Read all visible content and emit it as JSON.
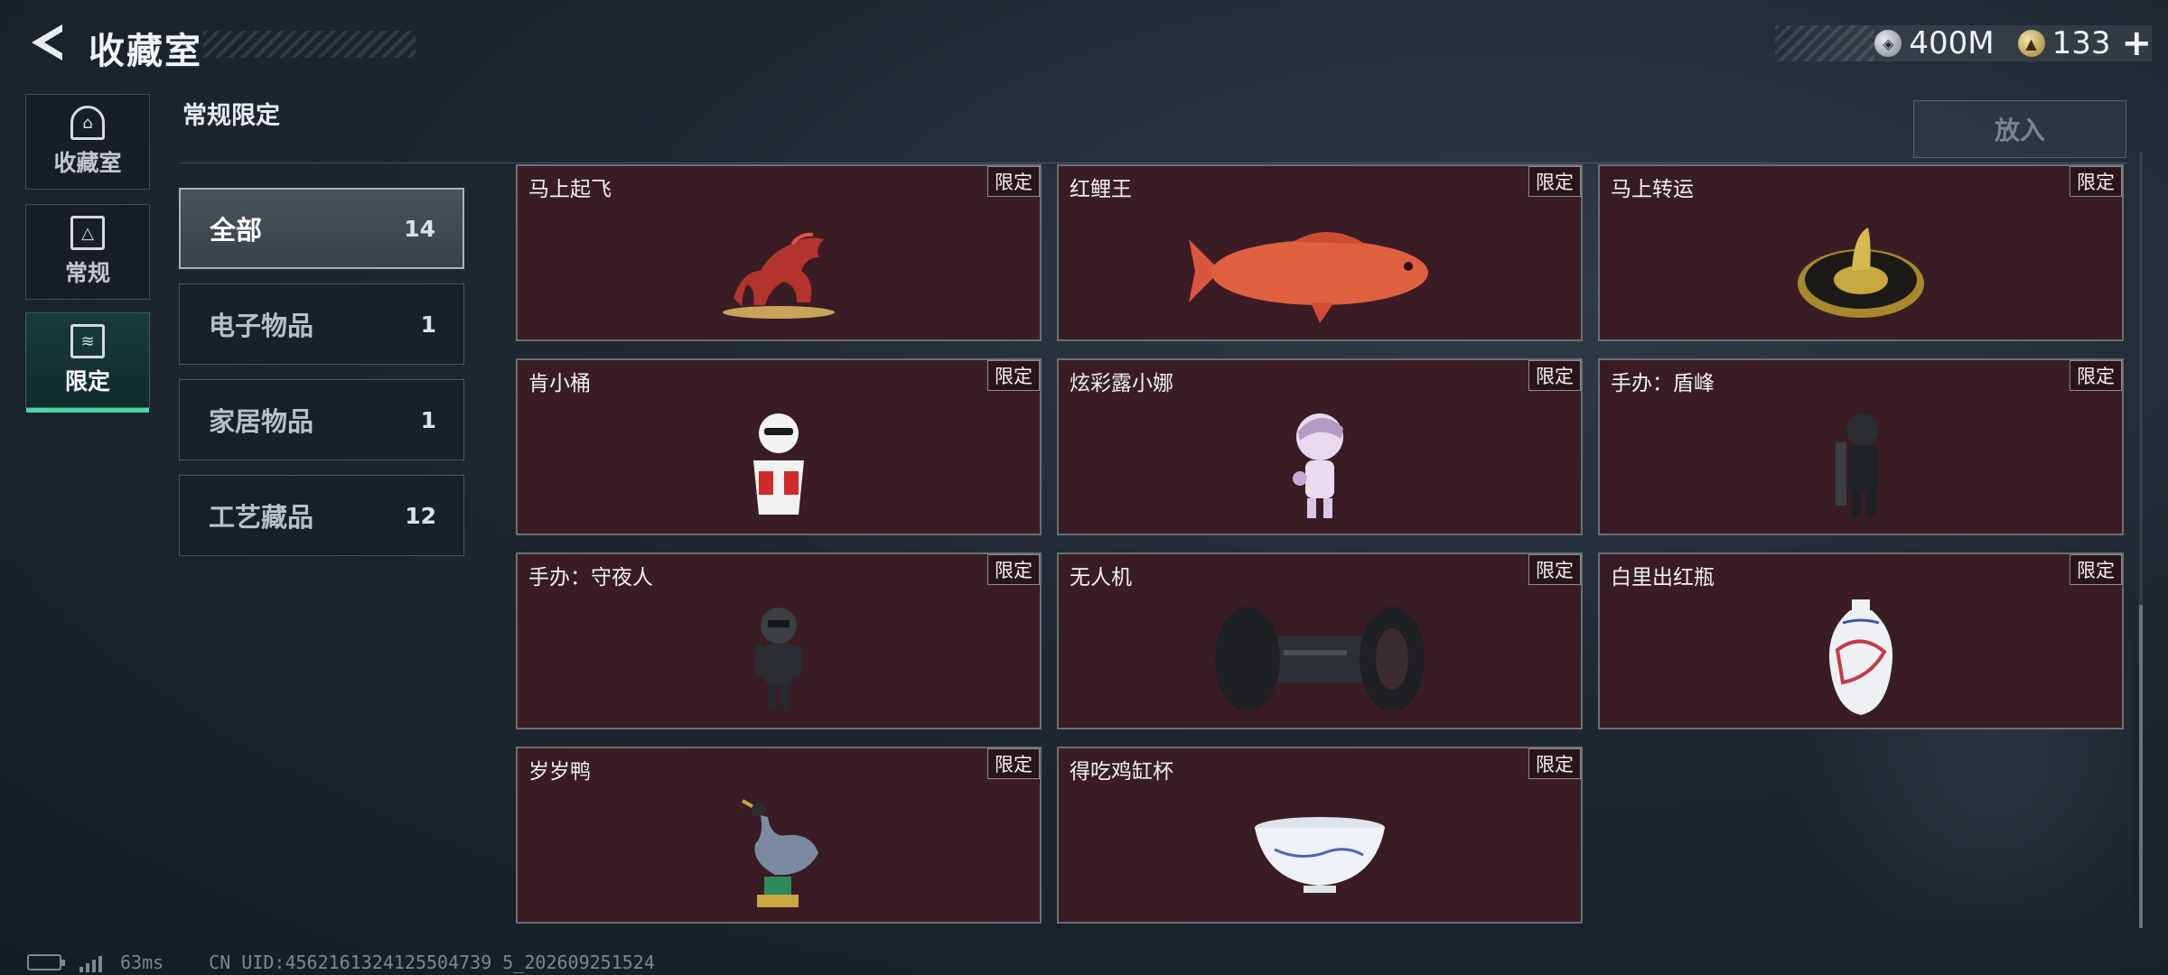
{
  "header": {
    "title": "收藏室",
    "currency": [
      {
        "icon": "silver-coin-icon",
        "value": "400M"
      },
      {
        "icon": "gold-coin-icon",
        "value": "133"
      }
    ],
    "plus": "+"
  },
  "nav": [
    {
      "label": "收藏室",
      "icon": "collection-icon",
      "active": false
    },
    {
      "label": "常规",
      "icon": "regular-icon",
      "active": false
    },
    {
      "label": "限定",
      "icon": "limited-icon",
      "active": true
    }
  ],
  "section_title": "常规限定",
  "put_button": "放入",
  "categories": [
    {
      "label": "全部",
      "count": "14",
      "active": true
    },
    {
      "label": "电子物品",
      "count": "1",
      "active": false
    },
    {
      "label": "家居物品",
      "count": "1",
      "active": false
    },
    {
      "label": "工艺藏品",
      "count": "12",
      "active": false
    }
  ],
  "items": [
    {
      "name": "马上起飞",
      "tag": "限定",
      "art": "horse"
    },
    {
      "name": "红鲤王",
      "tag": "限定",
      "art": "fish"
    },
    {
      "name": "马上转运",
      "tag": "限定",
      "art": "medallion"
    },
    {
      "name": "肯小桶",
      "tag": "限定",
      "art": "figure-white"
    },
    {
      "name": "炫彩露小娜",
      "tag": "限定",
      "art": "figure-pink"
    },
    {
      "name": "手办：盾峰",
      "tag": "限定",
      "art": "figure-armor"
    },
    {
      "name": "手办：守夜人",
      "tag": "限定",
      "art": "figure-dark"
    },
    {
      "name": "无人机",
      "tag": "限定",
      "art": "drone"
    },
    {
      "name": "白里出红瓶",
      "tag": "限定",
      "art": "vase"
    },
    {
      "name": "岁岁鸭",
      "tag": "限定",
      "art": "duck"
    },
    {
      "name": "得吃鸡缸杯",
      "tag": "限定",
      "art": "cup"
    }
  ],
  "status": {
    "ping": "63ms",
    "uid": "CN UID:4562161324125504739 5_202609251524"
  }
}
